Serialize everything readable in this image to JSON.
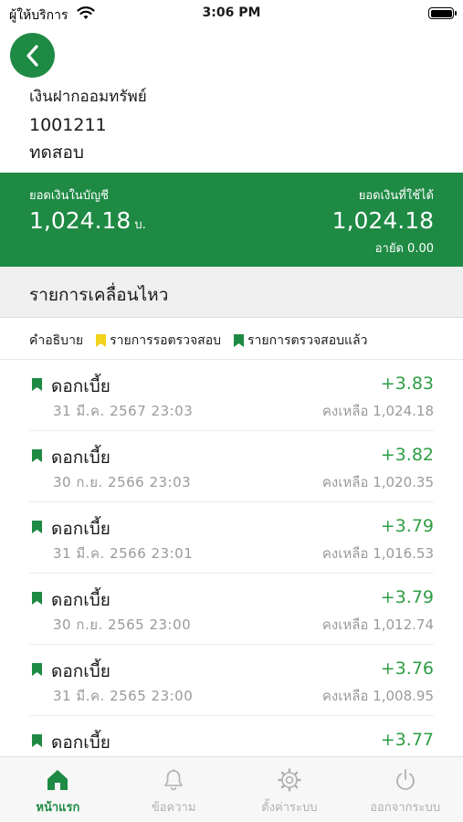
{
  "status_bar": {
    "carrier": "ผู้ให้บริการ",
    "time": "3:06 PM"
  },
  "account": {
    "type": "เงินฝากออมทรัพย์",
    "number": "1001211",
    "name": "ทดสอบ"
  },
  "balance": {
    "ledger_label": "ยอดเงินในบัญชี",
    "ledger_value": "1,024.18",
    "ledger_unit": "บ.",
    "available_label": "ยอดเงินที่ใช้ได้",
    "available_value": "1,024.18",
    "hold": "อายัด 0.00"
  },
  "section": {
    "title": "รายการเคลื่อนไหว"
  },
  "legend": {
    "label": "คำอธิบาย",
    "pending": "รายการรอตรวจสอบ",
    "verified": "รายการตรวจสอบแล้ว"
  },
  "colors": {
    "brand": "#1e8a44",
    "pending": "#f2d21b",
    "amount": "#2e9e45"
  },
  "transactions": [
    {
      "desc": "ดอกเบี้ย",
      "date": "31 มี.ค. 2567 23:03",
      "amount": "+3.83",
      "balance": "คงเหลือ 1,024.18"
    },
    {
      "desc": "ดอกเบี้ย",
      "date": "30 ก.ย. 2566 23:03",
      "amount": "+3.82",
      "balance": "คงเหลือ 1,020.35"
    },
    {
      "desc": "ดอกเบี้ย",
      "date": "31 มี.ค. 2566 23:01",
      "amount": "+3.79",
      "balance": "คงเหลือ 1,016.53"
    },
    {
      "desc": "ดอกเบี้ย",
      "date": "30 ก.ย. 2565 23:00",
      "amount": "+3.79",
      "balance": "คงเหลือ 1,012.74"
    },
    {
      "desc": "ดอกเบี้ย",
      "date": "31 มี.ค. 2565 23:00",
      "amount": "+3.76",
      "balance": "คงเหลือ 1,008.95"
    },
    {
      "desc": "ดอกเบี้ย",
      "date": "",
      "amount": "+3.77",
      "balance": ""
    }
  ],
  "tabs": [
    {
      "label": "หน้าแรก",
      "icon": "home-icon",
      "active": true
    },
    {
      "label": "ข้อความ",
      "icon": "bell-icon",
      "active": false
    },
    {
      "label": "ตั้งค่าระบบ",
      "icon": "gear-icon",
      "active": false
    },
    {
      "label": "ออกจากระบบ",
      "icon": "power-icon",
      "active": false
    }
  ]
}
